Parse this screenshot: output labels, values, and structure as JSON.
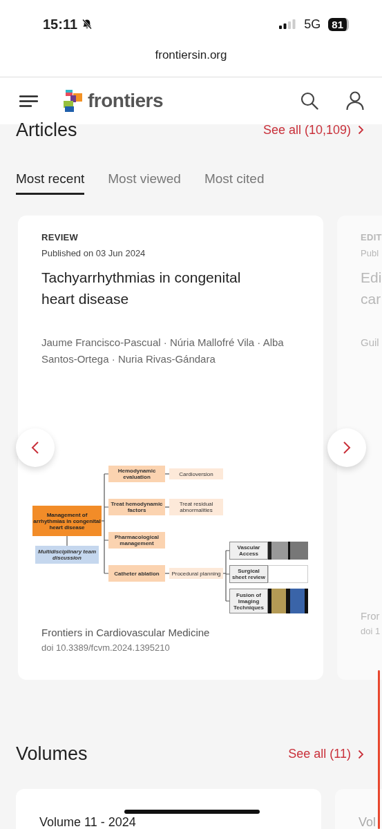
{
  "status_bar": {
    "time": "15:11",
    "network": "5G",
    "battery": "81"
  },
  "browser": {
    "url": "frontiersin.org"
  },
  "header": {
    "logo_text": "frontiers"
  },
  "articles": {
    "title": "Articles",
    "see_all": "See all (10,109)",
    "tabs": [
      {
        "label": "Most recent",
        "selected": true
      },
      {
        "label": "Most viewed",
        "selected": false
      },
      {
        "label": "Most cited",
        "selected": false
      }
    ],
    "cards": [
      {
        "type": "REVIEW",
        "published": "Published on 03 Jun 2024",
        "title_lines": [
          "Tachyarrhythmias in congenital",
          "heart disease"
        ],
        "authors": "Jaume Francisco-Pascual · Núria Mallofré Vila · Alba Santos-Ortega · Nuria Rivas-Gándara",
        "journal": "Frontiers in Cardiovascular Medicine",
        "doi": "doi 10.3389/fcvm.2024.1395210",
        "faded": false,
        "figure": {
          "root": "Management of arrhythmias in congenital heart disease",
          "note": "Multidisciplinary team discussion",
          "branches": [
            {
              "label": "Hemodynamic evaluation",
              "next": "Cardioversion"
            },
            {
              "label": "Treat hemodynamic factors",
              "next": "Treat residual abnormalities"
            },
            {
              "label": "Pharmacological management"
            },
            {
              "label": "Catheter ablation",
              "next": "Procedural planning"
            }
          ],
          "planning": [
            "Vascular Access",
            "Surgical sheet review",
            "Fusion of Imaging Techniques"
          ]
        }
      },
      {
        "type": "EDIT",
        "published": "Publ",
        "title_lines": [
          "Edi",
          "car"
        ],
        "authors": "Guil",
        "journal": "Fror",
        "doi": "doi 1",
        "faded": true
      }
    ]
  },
  "volumes": {
    "title": "Volumes",
    "see_all": "See all (11)",
    "cards": [
      {
        "title": "Volume 11 - 2024",
        "faded": false
      },
      {
        "title": "Vol",
        "faded": true
      }
    ]
  }
}
